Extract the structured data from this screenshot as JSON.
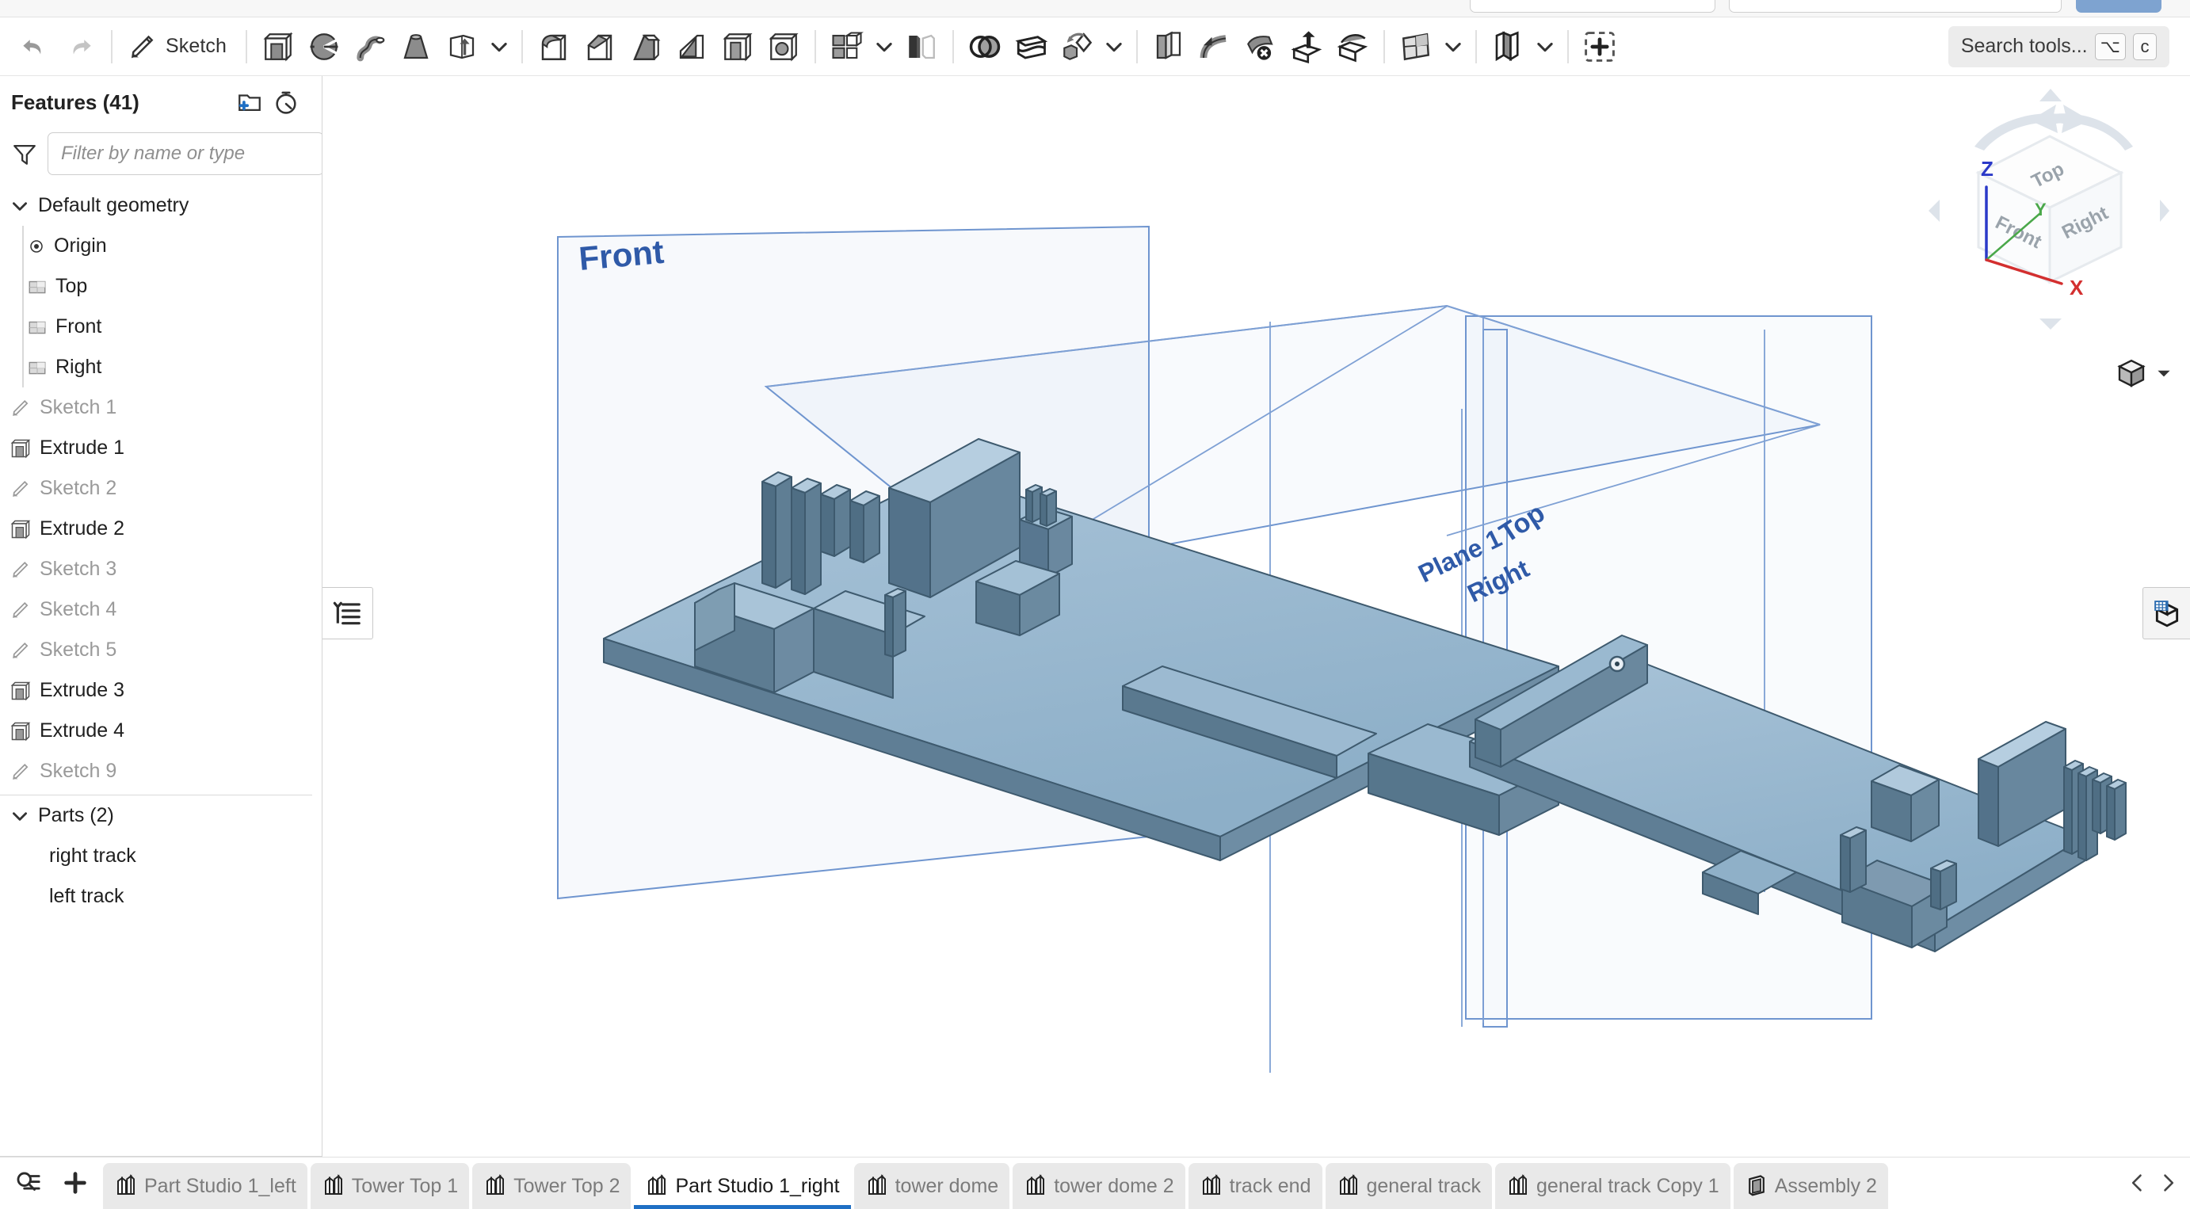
{
  "toolbar": {
    "undo_title": "Undo",
    "redo_title": "Redo",
    "sketch_label": "Sketch",
    "items": [
      {
        "name": "extrude-icon",
        "title": "Extrude"
      },
      {
        "name": "revolve-icon",
        "title": "Revolve"
      },
      {
        "name": "sweep-icon",
        "title": "Sweep"
      },
      {
        "name": "loft-icon",
        "title": "Loft"
      },
      {
        "name": "thicken-icon",
        "title": "Thicken"
      },
      {
        "name": "fillet-icon",
        "title": "Fillet"
      },
      {
        "name": "chamfer-icon",
        "title": "Chamfer"
      },
      {
        "name": "draft-icon",
        "title": "Draft"
      },
      {
        "name": "rib-icon",
        "title": "Rib"
      },
      {
        "name": "shell-icon",
        "title": "Shell"
      },
      {
        "name": "hole-icon",
        "title": "Hole"
      },
      {
        "name": "linear-pattern-icon",
        "title": "Linear pattern"
      },
      {
        "name": "mirror-icon",
        "title": "Mirror"
      },
      {
        "name": "boolean-icon",
        "title": "Boolean"
      },
      {
        "name": "split-icon",
        "title": "Split"
      },
      {
        "name": "transform-icon",
        "title": "Transform"
      },
      {
        "name": "sheet-metal-icon",
        "title": "Sheet metal model"
      },
      {
        "name": "bend-icon",
        "title": "Sheet metal bend"
      },
      {
        "name": "unfold-icon",
        "title": "Unfold"
      },
      {
        "name": "fold-icon",
        "title": "Fold"
      },
      {
        "name": "plane-icon",
        "title": "Plane"
      },
      {
        "name": "derive-icon",
        "title": "Derive"
      },
      {
        "name": "add-custom-feature-icon",
        "title": "Add custom feature"
      }
    ],
    "search_placeholder": "Search tools...",
    "search_shortcut_mod": "⌥",
    "search_shortcut_key": "c"
  },
  "features_panel": {
    "title": "Features (41)",
    "new_folder_icon": "new-folder-icon",
    "rollback_timer_icon": "feature-timer-icon",
    "filter_icon": "filter-icon",
    "filter_placeholder": "Filter by name or type",
    "default_geometry": {
      "label": "Default geometry",
      "expanded": true,
      "children": [
        {
          "label": "Origin",
          "icon": "origin-icon",
          "dim": false
        },
        {
          "label": "Top",
          "icon": "plane-icon",
          "dim": false
        },
        {
          "label": "Front",
          "icon": "plane-icon",
          "dim": false
        },
        {
          "label": "Right",
          "icon": "plane-icon",
          "dim": false
        }
      ]
    },
    "features": [
      {
        "label": "Sketch 1",
        "icon": "sketch-icon",
        "dim": true
      },
      {
        "label": "Extrude 1",
        "icon": "extrude-icon",
        "dim": false
      },
      {
        "label": "Sketch 2",
        "icon": "sketch-icon",
        "dim": true
      },
      {
        "label": "Extrude 2",
        "icon": "extrude-icon",
        "dim": false
      },
      {
        "label": "Sketch 3",
        "icon": "sketch-icon",
        "dim": true
      },
      {
        "label": "Sketch 4",
        "icon": "sketch-icon",
        "dim": true
      },
      {
        "label": "Sketch 5",
        "icon": "sketch-icon",
        "dim": true
      },
      {
        "label": "Extrude 3",
        "icon": "extrude-icon",
        "dim": false
      },
      {
        "label": "Extrude 4",
        "icon": "extrude-icon",
        "dim": false
      },
      {
        "label": "Sketch 9",
        "icon": "sketch-icon",
        "dim": true
      }
    ],
    "parts": {
      "label": "Parts (2)",
      "expanded": true,
      "items": [
        {
          "label": "right track"
        },
        {
          "label": "left track"
        }
      ]
    }
  },
  "viewport": {
    "plane_labels": [
      {
        "name": "front-plane-label",
        "text": "Front"
      },
      {
        "name": "top-plane-label",
        "text": "Top"
      },
      {
        "name": "plane1-label",
        "text": "Plane 1"
      },
      {
        "name": "right-plane-label",
        "text": "Right"
      }
    ],
    "view_cube": {
      "top_face": "Top",
      "front_face": "Front",
      "right_face": "Right",
      "axis_z": "Z",
      "axis_y": "Y",
      "axis_x": "X",
      "axis_z_color": "#2b39c8",
      "axis_y_color": "#4aa84a",
      "axis_x_color": "#d32f2f"
    },
    "display_mode_icon": "shaded-cube-icon",
    "flyout_icon": "feature-list-icon",
    "appearance_icon": "appearance-cube-icon",
    "part_face_color": "#93b4cc",
    "plane_color": "#5b86c4"
  },
  "tabbar": {
    "search_tabs_icon": "search-tabs-icon",
    "add_tab_icon": "add-tab-icon",
    "tabs": [
      {
        "label": "Part Studio 1_left",
        "icon": "part-studio-icon",
        "active": false
      },
      {
        "label": "Tower Top 1",
        "icon": "part-studio-icon",
        "active": false
      },
      {
        "label": "Tower Top 2",
        "icon": "part-studio-icon",
        "active": false
      },
      {
        "label": "Part Studio 1_right",
        "icon": "part-studio-icon",
        "active": true
      },
      {
        "label": "tower dome",
        "icon": "part-studio-icon",
        "active": false
      },
      {
        "label": "tower dome 2",
        "icon": "part-studio-icon",
        "active": false
      },
      {
        "label": "track end",
        "icon": "part-studio-icon",
        "active": false
      },
      {
        "label": "general track",
        "icon": "part-studio-icon",
        "active": false
      },
      {
        "label": "general track Copy 1",
        "icon": "part-studio-icon",
        "active": false
      },
      {
        "label": "Assembly 2",
        "icon": "assembly-icon",
        "active": false
      }
    ],
    "prev_icon": "chevron-left-icon",
    "next_icon": "chevron-right-icon",
    "active_underline_color": "#1f6fc4"
  }
}
